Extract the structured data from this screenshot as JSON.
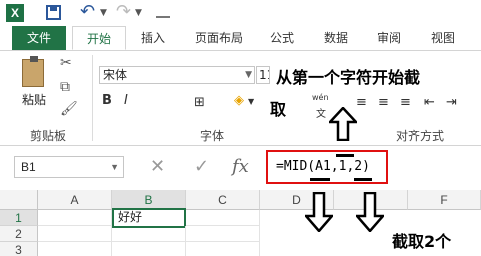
{
  "qat": {
    "app_icon": "X"
  },
  "tabs": [
    "文件",
    "开始",
    "插入",
    "页面布局",
    "公式",
    "数据",
    "审阅",
    "视图"
  ],
  "ribbon": {
    "paste_label": "粘贴",
    "font_name": "宋体",
    "font_size": "11",
    "clipboard_group": "剪贴板",
    "font_group": "字体",
    "align_group": "对齐方式",
    "phonetic_label": "wén"
  },
  "annotations": {
    "top": "从第一个字符开始截",
    "top2": "取",
    "bottom": "截取2个"
  },
  "formula_bar": {
    "name_box": "B1",
    "fx": "fx",
    "formula": "=MID(A1,1,2)"
  },
  "grid": {
    "columns": [
      "A",
      "B",
      "C",
      "D",
      "E",
      "F"
    ],
    "rows": [
      "1",
      "2",
      "3"
    ],
    "cells": {
      "B1": "好好"
    }
  },
  "colors": {
    "accent": "#217346",
    "highlight": "#e01010"
  }
}
